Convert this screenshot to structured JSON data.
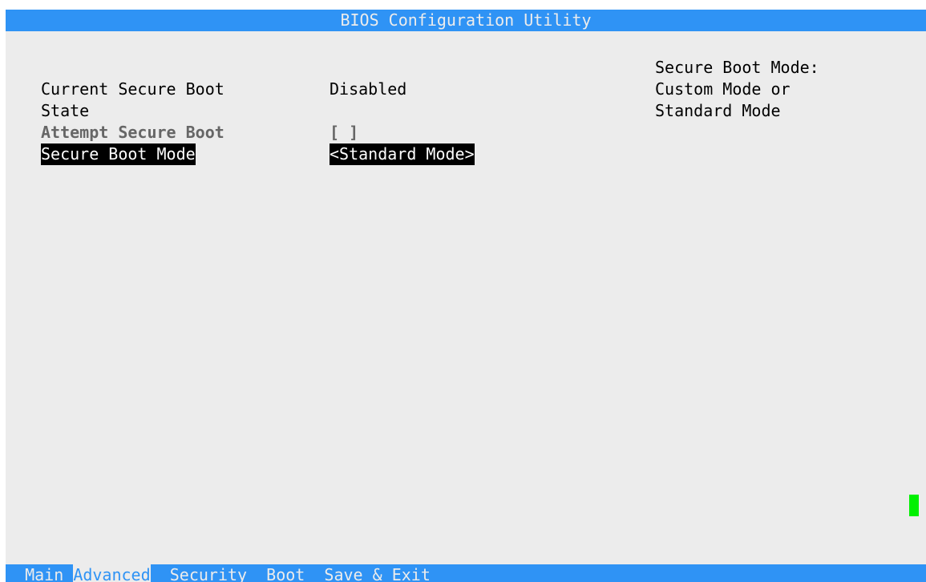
{
  "title": "BIOS Configuration Utility",
  "items": [
    {
      "label": "Current Secure Boot",
      "label_line2": "State",
      "value": "Disabled"
    },
    {
      "label": "Attempt Secure Boot",
      "value": "[ ]"
    },
    {
      "label": "Secure Boot Mode",
      "value": "<Standard Mode>"
    }
  ],
  "help": [
    "Secure Boot Mode:",
    "Custom Mode or",
    "Standard Mode"
  ],
  "menu": {
    "tabs": [
      "Main",
      "Advanced",
      "Security",
      "Boot",
      "Save & Exit"
    ],
    "active": "Advanced"
  },
  "colors": {
    "title_bar": "#2f93f5",
    "background": "#ececec",
    "highlight": "#000000",
    "cursor": "#00f000"
  }
}
